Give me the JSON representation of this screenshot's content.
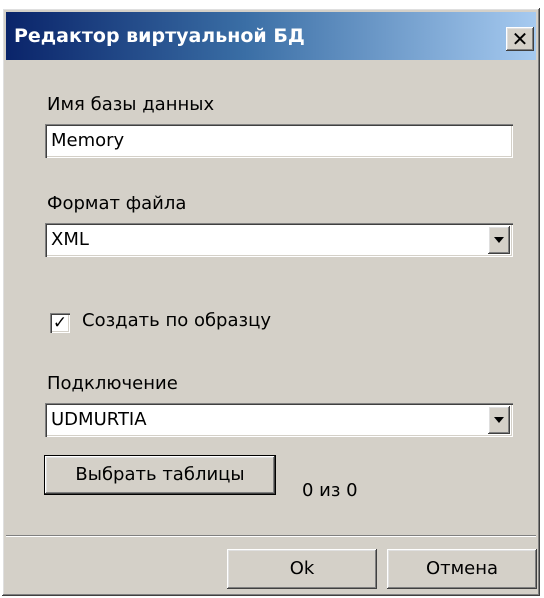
{
  "window": {
    "title": "Редактор виртуальной БД",
    "close_glyph": "✕"
  },
  "db_name": {
    "label": "Имя базы данных",
    "value": "Memory"
  },
  "file_format": {
    "label": "Формат файла",
    "selected": "XML"
  },
  "create_by_sample": {
    "label": "Создать по образцу",
    "checked": true,
    "check_glyph": "✓"
  },
  "connection": {
    "label": "Подключение",
    "selected": "UDMURTIA"
  },
  "select_tables": {
    "button_label": "Выбрать таблицы",
    "count_text": "0 из 0"
  },
  "footer": {
    "ok_label": "Ok",
    "cancel_label": "Отмена"
  },
  "icons": {
    "close": "close-icon",
    "dropdown": "chevron-down-icon",
    "check": "check-icon"
  }
}
